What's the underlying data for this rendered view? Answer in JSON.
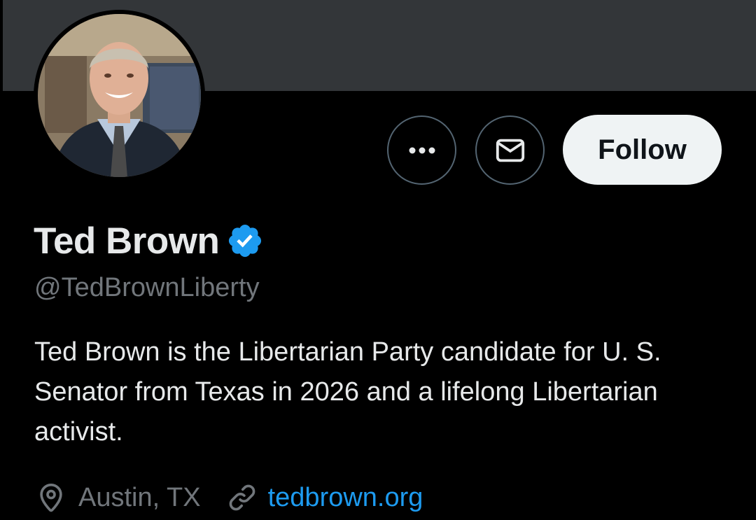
{
  "banner": {
    "color": "#333639"
  },
  "profile": {
    "display_name": "Ted Brown",
    "verified_icon": "verified-badge-icon",
    "handle": "@TedBrownLiberty",
    "bio": "Ted Brown is the Libertarian Party candidate for U. S. Senator from Texas in 2026 and a lifelong Libertarian activist.",
    "location": "Austin, TX",
    "website": "tedbrown.org"
  },
  "actions": {
    "more_icon": "more-options-icon",
    "message_icon": "envelope-icon",
    "follow_label": "Follow"
  },
  "colors": {
    "background": "#000000",
    "primary_text": "#e7e9ea",
    "secondary_text": "#71767b",
    "accent": "#1d9bf0",
    "button_border": "#536471",
    "follow_bg": "#eff3f4"
  }
}
